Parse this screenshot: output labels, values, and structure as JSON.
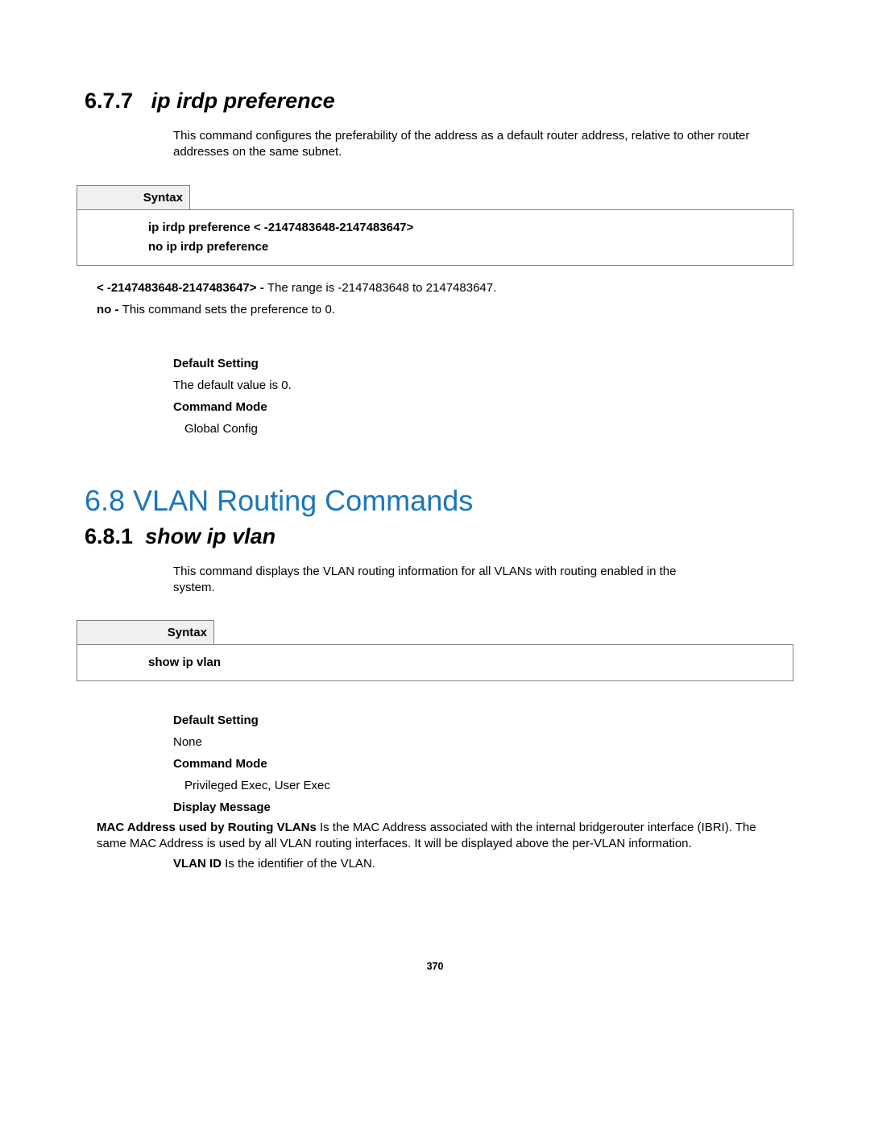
{
  "section_677": {
    "number": "6.7.7",
    "title": "ip irdp preference",
    "desc": "This command configures the preferability of the address as a default router address, relative to other router addresses on the same subnet.",
    "syntax_label": "Syntax",
    "syntax_line1": "ip irdp preference < -2147483648-2147483647>",
    "syntax_line2": "no ip irdp preference",
    "param1_bold": "< -2147483648-2147483647> - ",
    "param1_text": "The range is -2147483648 to 2147483647.",
    "param2_bold": "no - ",
    "param2_text": "This command sets the preference to 0.",
    "default_setting_hd": "Default Setting",
    "default_setting_val": "The default value is 0.",
    "command_mode_hd": "Command Mode",
    "command_mode_val": "Global Config"
  },
  "section_68": {
    "heading": "6.8 VLAN Routing Commands"
  },
  "section_681": {
    "number": "6.8.1",
    "title": "show ip vlan",
    "desc_line1": "This command displays the VLAN routing information for all VLANs with routing enabled in the",
    "desc_line2": "system.",
    "syntax_label": "Syntax",
    "syntax_line1": "show ip vlan",
    "default_setting_hd": "Default Setting",
    "default_setting_val": "None",
    "command_mode_hd": "Command Mode",
    "command_mode_val": "Privileged Exec, User Exec",
    "display_message_hd": "Display Message",
    "mac_bold": "MAC Address used by Routing VLANs ",
    "mac_text": "Is the MAC Address associated with the internal bridgerouter interface (IBRI). The same MAC Address is used by all VLAN routing interfaces. It will be displayed above the per-VLAN information.",
    "vlanid_bold": "VLAN ID ",
    "vlanid_text": "Is the identifier of the VLAN."
  },
  "page_number": "370"
}
